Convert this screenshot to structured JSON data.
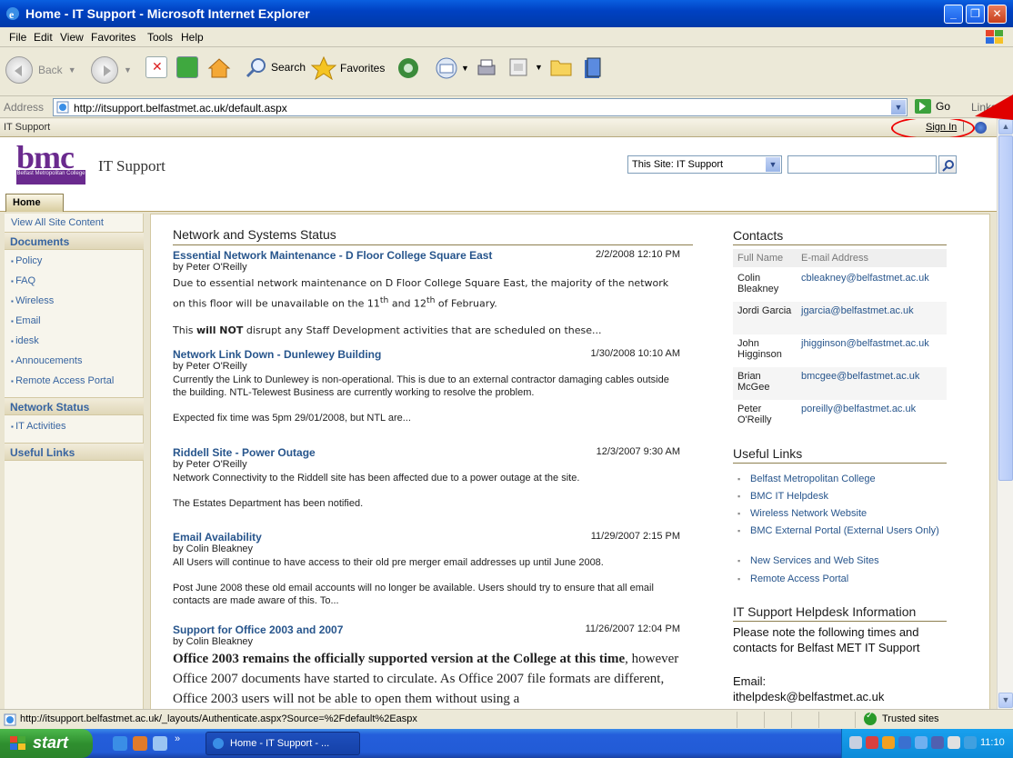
{
  "window": {
    "title": "Home - IT Support - Microsoft Internet Explorer"
  },
  "menu": [
    "File",
    "Edit",
    "View",
    "Favorites",
    "Tools",
    "Help"
  ],
  "toolbar": {
    "back": "Back",
    "search": "Search",
    "favorites": "Favorites"
  },
  "address": {
    "label": "Address",
    "url": "http://itsupport.belfastmet.ac.uk/default.aspx",
    "go": "Go",
    "links": "Links"
  },
  "sp": {
    "breadcrumb": "IT Support",
    "signin": "Sign In",
    "logo_text": "bmc",
    "logo_sub": "Belfast Metropolitan College",
    "site_title": "IT Support",
    "home_tab": "Home",
    "scope": "This Site: IT Support"
  },
  "quicklaunch": {
    "view_all": "View All Site Content",
    "documents": "Documents",
    "doc_items": [
      "Policy",
      "FAQ",
      "Wireless",
      "Email",
      "idesk",
      "Annoucements",
      "Remote Access Portal"
    ],
    "network_status": "Network Status",
    "net_items": [
      "IT Activities"
    ],
    "useful_links": "Useful Links"
  },
  "announcements": {
    "title": "Network and Systems Status",
    "items": [
      {
        "title": "Essential Network Maintenance - D Floor College Square East",
        "date": "2/2/2008 12:10 PM",
        "by": "by Peter O'Reilly",
        "p1a": "Due to essential network maintenance on D Floor College Square East, the majority of the network on this floor will be unavailable on the 11",
        "sup1": "th",
        "and": " and 12",
        "sup2": "th",
        "p1b": " of February.",
        "p2a": "This ",
        "p2b": "will NOT",
        "p2c": " disrupt any Staff Development activities that are scheduled on these..."
      },
      {
        "title": "Network Link Down - Dunlewey Building",
        "date": "1/30/2008 10:10 AM",
        "by": "by Peter O'Reilly",
        "p1": "Currently the Link to Dunlewey is non-operational. This is due to an external contractor damaging cables outside the building. NTL-Telewest Business are currently working to resolve the problem.",
        "p2": "Expected fix time was 5pm 29/01/2008, but NTL are..."
      },
      {
        "title": "Riddell Site - Power Outage",
        "date": "12/3/2007 9:30 AM",
        "by": "by Peter O'Reilly",
        "p1": "Network Connectivity to the Riddell site has been affected due to a power outage at the site.",
        "p2": "The Estates Department has been notified."
      },
      {
        "title": "Email Availability",
        "date": "11/29/2007 2:15 PM",
        "by": "by Colin Bleakney",
        "p1": "All Users will continue to have access to their old pre merger email addresses up until June 2008.",
        "p2": "Post June 2008 these old email accounts will no longer be available. Users should try to ensure that all email contacts are made aware of  this. To..."
      },
      {
        "title": "Support for Office 2003 and 2007",
        "date": "11/26/2007 12:04 PM",
        "by": "by Colin Bleakney",
        "p1a": "Office 2003 remains the officially supported version at the College at this time",
        "p1b": ", however Office 2007 documents have started to circulate. As Office 2007 file formats are different, Office 2003 users will not be able to open them without using a"
      }
    ]
  },
  "contacts": {
    "title": "Contacts",
    "col_name": "Full Name",
    "col_email": "E-mail Address",
    "rows": [
      {
        "name": "Colin Bleakney",
        "email": "cbleakney@belfastmet.ac.uk"
      },
      {
        "name": "Jordi Garcia",
        "email": "jgarcia@belfastmet.ac.uk"
      },
      {
        "name": "John Higginson",
        "email": "jhigginson@belfastmet.ac.uk"
      },
      {
        "name": "Brian McGee",
        "email": "bmcgee@belfastmet.ac.uk"
      },
      {
        "name": "Peter O'Reilly",
        "email": "poreilly@belfastmet.ac.uk"
      }
    ]
  },
  "useful_links": {
    "title": "Useful Links",
    "items": [
      "Belfast Metropolitan College",
      "BMC IT Helpdesk",
      "Wireless Network Website",
      "BMC External Portal (External Users Only)",
      "New Services and Web Sites",
      "Remote Access Portal"
    ]
  },
  "helpdesk": {
    "title": "IT Support Helpdesk Information",
    "text": "Please note the following times and contacts for Belfast MET IT Support",
    "email_label": "Email:",
    "email": "ithelpdesk@belfastmet.ac.uk"
  },
  "status": {
    "url": "http://itsupport.belfastmet.ac.uk/_layouts/Authenticate.aspx?Source=%2Fdefault%2Easpx",
    "zone": "Trusted sites"
  },
  "taskbar": {
    "start": "start",
    "task": "Home - IT Support - ...",
    "clock": "11:10"
  },
  "colors": {
    "link": "#27558c",
    "quicklaunch_link": "#3764a0",
    "logo_purple": "#6a2a8e",
    "annotation_red": "#e00000"
  }
}
